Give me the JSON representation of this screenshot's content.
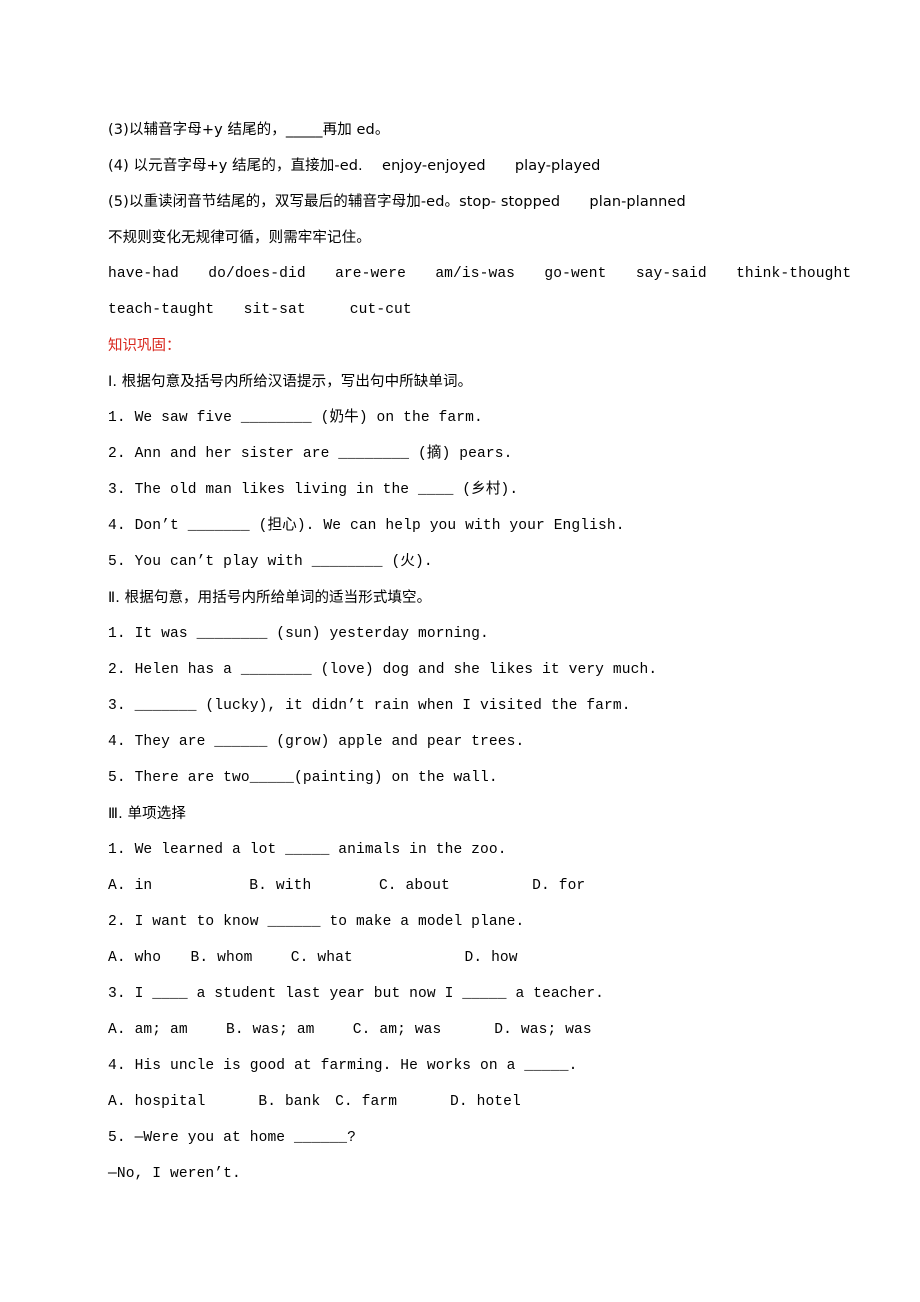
{
  "document": {
    "grammar_notes": {
      "rules": [
        "(3)以辅音字母+y 结尾的，_____再加 ed。",
        "(4) 以元音字母+y 结尾的，直接加-ed.　 enjoy-enjoyed　　play-played",
        "(5)以重读闭音节结尾的，双写最后的辅音字母加-ed。stop- stopped　　plan-planned",
        "不规则变化无规律可循，则需牢牢记住。"
      ],
      "irregular_verbs_line1": "have-had　　do/does-did　　are-were　　am/is-was　　go-went　　say-said　　think-thought",
      "irregular_verbs_line2": "teach-taught　　sit-sat　　　cut-cut"
    },
    "section_heading": "知识巩固：",
    "part1": {
      "title": "Ⅰ. 根据句意及括号内所给汉语提示，写出句中所缺单词。",
      "items": [
        "1. We saw five ________ (奶牛) on the farm.",
        "2. Ann and her sister are ________ (摘) pears.",
        "3. The old man likes living in the ____ (乡村).",
        "4. Don’t _______ (担心). We can help you with your English.",
        "5. You can’t play with ________ (火)."
      ]
    },
    "part2": {
      "title": "Ⅱ. 根据句意，用括号内所给单词的适当形式填空。",
      "items": [
        "1. It was ________ (sun) yesterday morning.",
        "2. Helen has a ________ (love) dog and she likes it very much.",
        "3. _______ (lucky), it didn’t rain when I visited the farm.",
        "4. They are ______ (grow) apple and pear trees.",
        "5. There are two_____(painting) on the wall."
      ]
    },
    "part3": {
      "title": "Ⅲ. 单项选择",
      "questions": [
        {
          "stem": "1. We learned a lot _____ animals in the zoo.",
          "options": "A. in　　　　　　 B. with　　　　 C. about　　　　　 D. for"
        },
        {
          "stem": "2. I want to know ______ to make a model plane.",
          "options": "A. who　　B. whom　　 C. what　　　　　　　 D. how"
        },
        {
          "stem": "3. I ____ a student last year but now I _____ a teacher.",
          "options": "A. am; am　　 B. was; am　　 C. am; was　　　 D. was; was"
        },
        {
          "stem": "4. His uncle is good at farming. He works on a _____.",
          "options": "A. hospital　　　 B. bank　C. farm　　　 D. hotel"
        },
        {
          "stem": "5. —Were you at home ______?",
          "options": "—No, I weren’t."
        }
      ]
    }
  }
}
